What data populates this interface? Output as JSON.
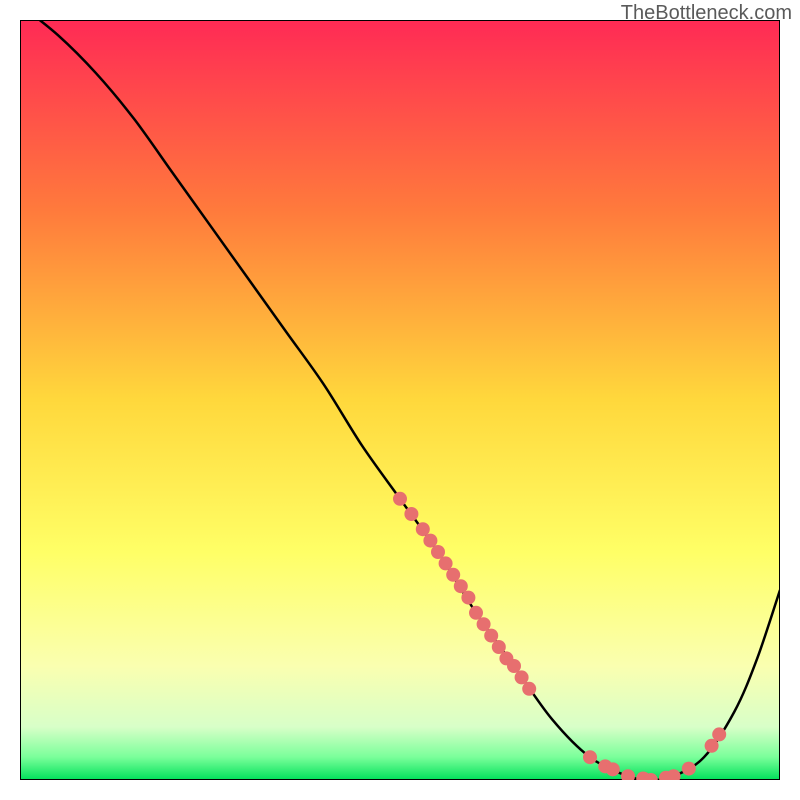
{
  "watermark": "TheBottleneck.com",
  "chart_data": {
    "type": "line",
    "title": "",
    "xlabel": "",
    "ylabel": "",
    "xlim": [
      0,
      100
    ],
    "ylim": [
      0,
      100
    ],
    "background_gradient": {
      "stops": [
        {
          "offset": 0,
          "color": "#ff2a55"
        },
        {
          "offset": 25,
          "color": "#ff7a3c"
        },
        {
          "offset": 50,
          "color": "#ffd83c"
        },
        {
          "offset": 70,
          "color": "#ffff66"
        },
        {
          "offset": 85,
          "color": "#faffb0"
        },
        {
          "offset": 93,
          "color": "#d8ffc8"
        },
        {
          "offset": 97,
          "color": "#7aff9a"
        },
        {
          "offset": 100,
          "color": "#00e05a"
        }
      ]
    },
    "series": [
      {
        "name": "bottleneck-curve",
        "color": "#000000",
        "x": [
          0,
          5,
          10,
          15,
          20,
          25,
          30,
          35,
          40,
          45,
          50,
          55,
          60,
          65,
          70,
          75,
          80,
          83,
          86,
          90,
          94,
          97,
          100
        ],
        "y": [
          102,
          98,
          93,
          87,
          80,
          73,
          66,
          59,
          52,
          44,
          37,
          30,
          22,
          15,
          8,
          3,
          0.5,
          0,
          0.5,
          3,
          9,
          16,
          25
        ]
      }
    ],
    "scatter_points": {
      "name": "data-points",
      "color": "#e76f6f",
      "radius": 7,
      "points": [
        {
          "x": 50,
          "y": 37
        },
        {
          "x": 51.5,
          "y": 35
        },
        {
          "x": 53,
          "y": 33
        },
        {
          "x": 54,
          "y": 31.5
        },
        {
          "x": 55,
          "y": 30
        },
        {
          "x": 56,
          "y": 28.5
        },
        {
          "x": 57,
          "y": 27
        },
        {
          "x": 58,
          "y": 25.5
        },
        {
          "x": 59,
          "y": 24
        },
        {
          "x": 60,
          "y": 22
        },
        {
          "x": 61,
          "y": 20.5
        },
        {
          "x": 62,
          "y": 19
        },
        {
          "x": 63,
          "y": 17.5
        },
        {
          "x": 64,
          "y": 16
        },
        {
          "x": 65,
          "y": 15
        },
        {
          "x": 66,
          "y": 13.5
        },
        {
          "x": 67,
          "y": 12
        },
        {
          "x": 75,
          "y": 3
        },
        {
          "x": 77,
          "y": 1.8
        },
        {
          "x": 78,
          "y": 1.4
        },
        {
          "x": 80,
          "y": 0.5
        },
        {
          "x": 82,
          "y": 0.2
        },
        {
          "x": 83,
          "y": 0
        },
        {
          "x": 85,
          "y": 0.3
        },
        {
          "x": 86,
          "y": 0.5
        },
        {
          "x": 88,
          "y": 1.5
        },
        {
          "x": 91,
          "y": 4.5
        },
        {
          "x": 92,
          "y": 6
        }
      ]
    }
  }
}
